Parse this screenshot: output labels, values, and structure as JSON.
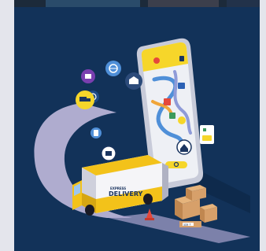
{
  "illustration": {
    "background_color": "#123259",
    "van_label_small": "EXPRESS",
    "van_label_large": "DELIVERY",
    "box_label": "123 ↑",
    "colors": {
      "phone_yellow": "#f6d62a",
      "route_blue": "#4f8fd8",
      "van_yellow": "#f3c21a",
      "box_tan": "#d7a06a",
      "road_lavender": "#b8b3d6"
    },
    "icons": [
      "gift-icon",
      "compass-icon",
      "globe-icon",
      "truck-icon",
      "warehouse-icon",
      "map-pin-icon",
      "house-icon",
      "box-icon",
      "search-icon",
      "phone-icon"
    ]
  }
}
